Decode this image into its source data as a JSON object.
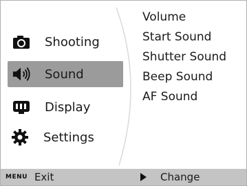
{
  "menu": {
    "items": [
      {
        "label": "Shooting",
        "icon": "camera-icon",
        "selected": false
      },
      {
        "label": "Sound",
        "icon": "speaker-icon",
        "selected": true
      },
      {
        "label": "Display",
        "icon": "display-icon",
        "selected": false
      },
      {
        "label": "Settings",
        "icon": "gear-icon",
        "selected": false
      }
    ]
  },
  "submenu": {
    "items": [
      "Volume",
      "Start Sound",
      "Shutter Sound",
      "Beep Sound",
      "AF Sound"
    ]
  },
  "footer": {
    "menu_key": "MENU",
    "exit_label": "Exit",
    "change_icon": "play-icon",
    "change_label": "Change"
  },
  "colors": {
    "selected_bg": "#9b9b9b",
    "footer_bg": "#c4c4c4",
    "text": "#1a1a1a"
  }
}
